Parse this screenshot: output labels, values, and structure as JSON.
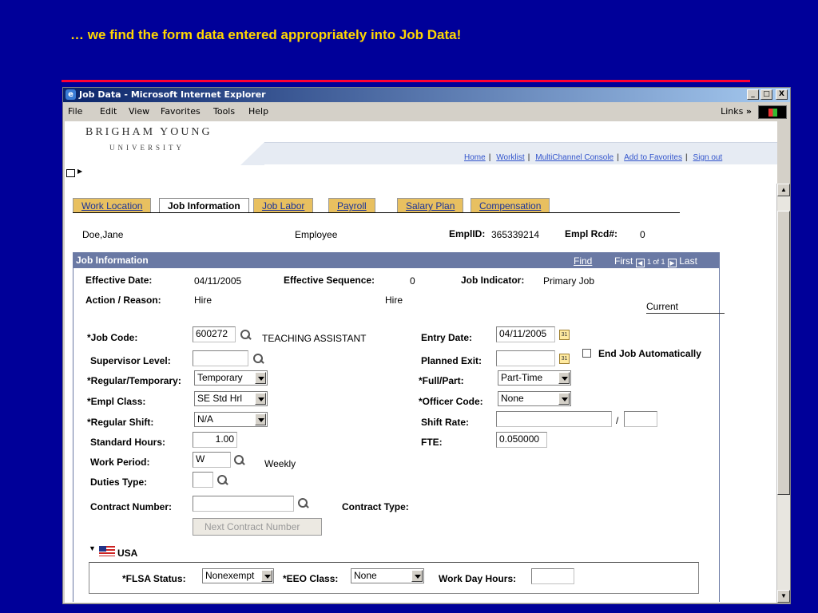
{
  "caption": "… we find the form data entered appropriately into Job Data!",
  "browser": {
    "title": "Job Data - Microsoft Internet Explorer",
    "menu": [
      "File",
      "Edit",
      "View",
      "Favorites",
      "Tools",
      "Help"
    ],
    "links_label": "Links",
    "links_chevron": "»",
    "win_buttons": [
      "_",
      "□",
      "X"
    ]
  },
  "header": {
    "logo_line1": "BRIGHAM YOUNG",
    "logo_line2": "UNIVERSITY",
    "nav": [
      "Home",
      "Worklist",
      "MultiChannel Console",
      "Add to Favorites",
      "Sign out"
    ]
  },
  "tabs": [
    {
      "label": "Work Location",
      "active": false
    },
    {
      "label": "Job Information",
      "active": true
    },
    {
      "label": "Job Labor",
      "active": false
    },
    {
      "label": "Payroll",
      "active": false
    },
    {
      "label": "Salary Plan",
      "active": false
    },
    {
      "label": "Compensation",
      "active": false
    }
  ],
  "employee": {
    "name": "Doe,Jane",
    "type": "Employee",
    "emplid_label": "EmplID:",
    "emplid": "365339214",
    "rcd_label": "Empl Rcd#:",
    "rcd": "0"
  },
  "section": {
    "title": "Job Information",
    "find": "Find",
    "first": "First",
    "count": "1 of 1",
    "last": "Last"
  },
  "summary": {
    "eff_date_label": "Effective Date:",
    "eff_date": "04/11/2005",
    "eff_seq_label": "Effective Sequence:",
    "eff_seq": "0",
    "job_ind_label": "Job Indicator:",
    "job_ind": "Primary Job",
    "action_label": "Action / Reason:",
    "action": "Hire",
    "reason": "Hire",
    "status": "Current"
  },
  "form": {
    "job_code_label": "*Job Code:",
    "job_code": "600272",
    "job_code_desc": "TEACHING ASSISTANT",
    "supervisor_label": "Supervisor Level:",
    "supervisor": "",
    "reg_temp_label": "*Regular/Temporary:",
    "reg_temp": "Temporary",
    "empl_class_label": "*Empl Class:",
    "empl_class": "SE Std Hrl",
    "reg_shift_label": "*Regular Shift:",
    "reg_shift": "N/A",
    "std_hours_label": "Standard Hours:",
    "std_hours": "1.00",
    "work_period_label": "Work Period:",
    "work_period": "W",
    "work_period_desc": "Weekly",
    "duties_label": "Duties Type:",
    "duties": "",
    "contract_num_label": "Contract Number:",
    "contract_num": "",
    "contract_type_label": "Contract Type:",
    "next_contract_btn": "Next Contract Number",
    "entry_date_label": "Entry Date:",
    "entry_date": "04/11/2005",
    "planned_exit_label": "Planned Exit:",
    "planned_exit": "",
    "end_job_label": "End Job Automatically",
    "end_job_checked": false,
    "full_part_label": "*Full/Part:",
    "full_part": "Part-Time",
    "officer_label": "*Officer Code:",
    "officer": "None",
    "shift_rate_label": "Shift Rate:",
    "shift_rate": "",
    "shift_rate_sep": "/",
    "fte_label": "FTE:",
    "fte": "0.050000",
    "calendar_glyph": "31"
  },
  "usa": {
    "label": "USA",
    "flsa_label": "*FLSA Status:",
    "flsa": "Nonexempt",
    "eeo_label": "*EEO Class:",
    "eeo": "None",
    "workday_label": "Work Day Hours:",
    "workday": ""
  }
}
